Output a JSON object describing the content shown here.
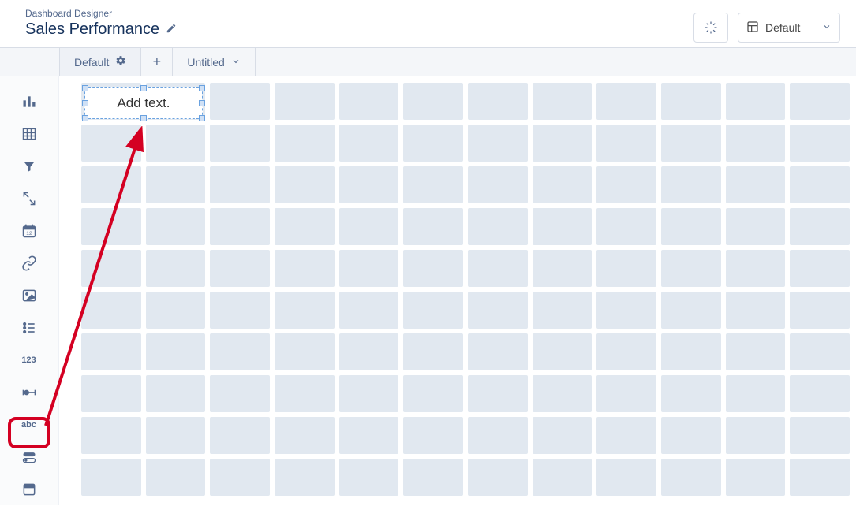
{
  "header": {
    "breadcrumb": "Dashboard Designer",
    "title": "Sales Performance",
    "layout_selector_label": "Default"
  },
  "tabs": {
    "active_label": "Default",
    "secondary_label": "Untitled"
  },
  "sidebar": {
    "items": [
      {
        "name": "chart",
        "icon": "chart-icon"
      },
      {
        "name": "table",
        "icon": "table-icon"
      },
      {
        "name": "filter",
        "icon": "filter-icon"
      },
      {
        "name": "global-filter",
        "icon": "global-filter-icon"
      },
      {
        "name": "date",
        "icon": "date-icon"
      },
      {
        "name": "link",
        "icon": "link-icon"
      },
      {
        "name": "image",
        "icon": "image-icon"
      },
      {
        "name": "list",
        "icon": "list-icon"
      },
      {
        "name": "number",
        "icon": "number-icon",
        "label": "123"
      },
      {
        "name": "range",
        "icon": "range-icon"
      },
      {
        "name": "text",
        "icon": "text-icon",
        "label": "abc"
      },
      {
        "name": "toggle",
        "icon": "toggle-icon"
      },
      {
        "name": "container",
        "icon": "container-icon"
      }
    ]
  },
  "canvas": {
    "text_widget_placeholder": "Add text.",
    "grid_cols": 12,
    "grid_rows": 10
  },
  "annotation": {
    "highlighted_sidebar_item": "text"
  }
}
